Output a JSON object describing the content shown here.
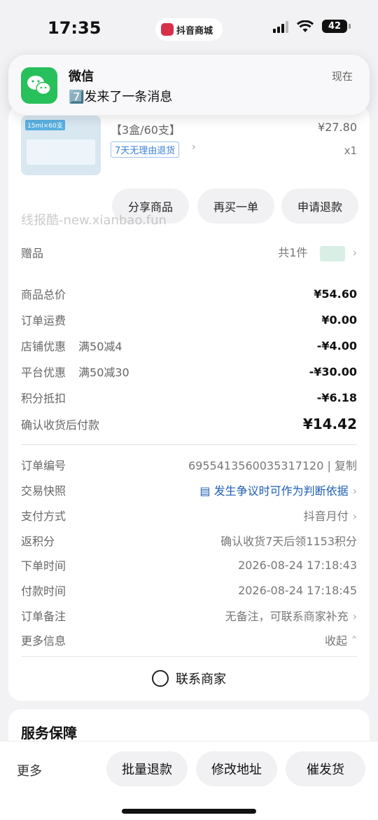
{
  "status_bar": {
    "time": "17:35",
    "island_app": "抖音商城",
    "battery": "42"
  },
  "notification": {
    "app": "微信",
    "message": "7️⃣发来了一条消息",
    "time": "现在"
  },
  "product": {
    "spec": "【3盒/60支】",
    "price": "¥27.80",
    "return_policy": "7天无理由退货",
    "quantity": "x1",
    "thumb_tag": "15ml×60支"
  },
  "actions": {
    "share": "分享商品",
    "rebuy": "再买一单",
    "refund": "申请退款"
  },
  "watermark": "线报酷-new.xianbao.fun",
  "gift": {
    "label": "赠品",
    "value": "共1件"
  },
  "prices": [
    {
      "label": "商品总价",
      "sub": "",
      "value": "¥54.60"
    },
    {
      "label": "订单运费",
      "sub": "",
      "value": "¥0.00"
    },
    {
      "label": "店铺优惠",
      "sub": "满50减4",
      "value": "-¥4.00"
    },
    {
      "label": "平台优惠",
      "sub": "满50减30",
      "value": "-¥30.00"
    },
    {
      "label": "积分抵扣",
      "sub": "",
      "value": "-¥6.18"
    },
    {
      "label": "确认收货后付款",
      "sub": "",
      "value": "¥14.42"
    }
  ],
  "order_info": {
    "order_no_label": "订单编号",
    "order_no": "6955413560035317120",
    "copy": "复制",
    "snapshot_label": "交易快照",
    "snapshot": "发生争议时可作为判断依据",
    "pay_label": "支付方式",
    "pay": "抖音月付",
    "points_label": "返积分",
    "points": "确认收货7天后领1153积分",
    "order_time_label": "下单时间",
    "order_time": "2026-08-24 17:18:43",
    "pay_time_label": "付款时间",
    "pay_time": "2026-08-24 17:18:45",
    "remark_label": "订单备注",
    "remark": "无备注，可联系商家补充",
    "more_label": "更多信息",
    "collapse": "收起"
  },
  "contact": "联系商家",
  "service_title": "服务保障",
  "bottom": {
    "more": "更多",
    "batch_refund": "批量退款",
    "change_address": "修改地址",
    "urge": "催发货"
  }
}
